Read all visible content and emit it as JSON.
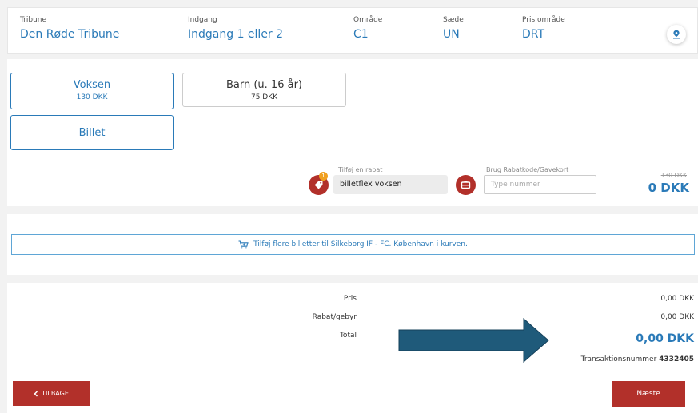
{
  "header": {
    "tribune_label": "Tribune",
    "tribune_value": "Den Røde Tribune",
    "indgang_label": "Indgang",
    "indgang_value": "Indgang 1 eller 2",
    "omrade_label": "Område",
    "omrade_value": "C1",
    "saede_label": "Sæde",
    "saede_value": "UN",
    "pris_label": "Pris område",
    "pris_value": "DRT"
  },
  "tickets": [
    {
      "label": "Voksen",
      "price": "130 DKK"
    },
    {
      "label": "Barn (u. 16 år)",
      "price": "75 DKK"
    }
  ],
  "ticket_type": {
    "label": "Billet"
  },
  "discount": {
    "label": "Tilføj en rabat",
    "value": "billetflex voksen",
    "badge": "1"
  },
  "voucher": {
    "label": "Brug Rabatkode/Gavekort",
    "placeholder": "Type nummer"
  },
  "price_line": {
    "old": "130 DKK",
    "new": "0 DKK"
  },
  "add_more": {
    "text": "Tilføj flere billetter til Silkeborg IF - FC. København i kurven."
  },
  "summary": {
    "pris_label": "Pris",
    "pris_value": "0,00 DKK",
    "rabat_label": "Rabat/gebyr",
    "rabat_value": "0,00 DKK",
    "total_label": "Total",
    "total_value": "0,00 DKK",
    "trans_label": "Transaktionsnummer",
    "trans_value": "4332405"
  },
  "nav": {
    "back": "TILBAGE",
    "next": "Næste"
  },
  "colors": {
    "accent": "#2a7ab8",
    "button": "#b2302a",
    "arrow": "#1f5a7a"
  }
}
